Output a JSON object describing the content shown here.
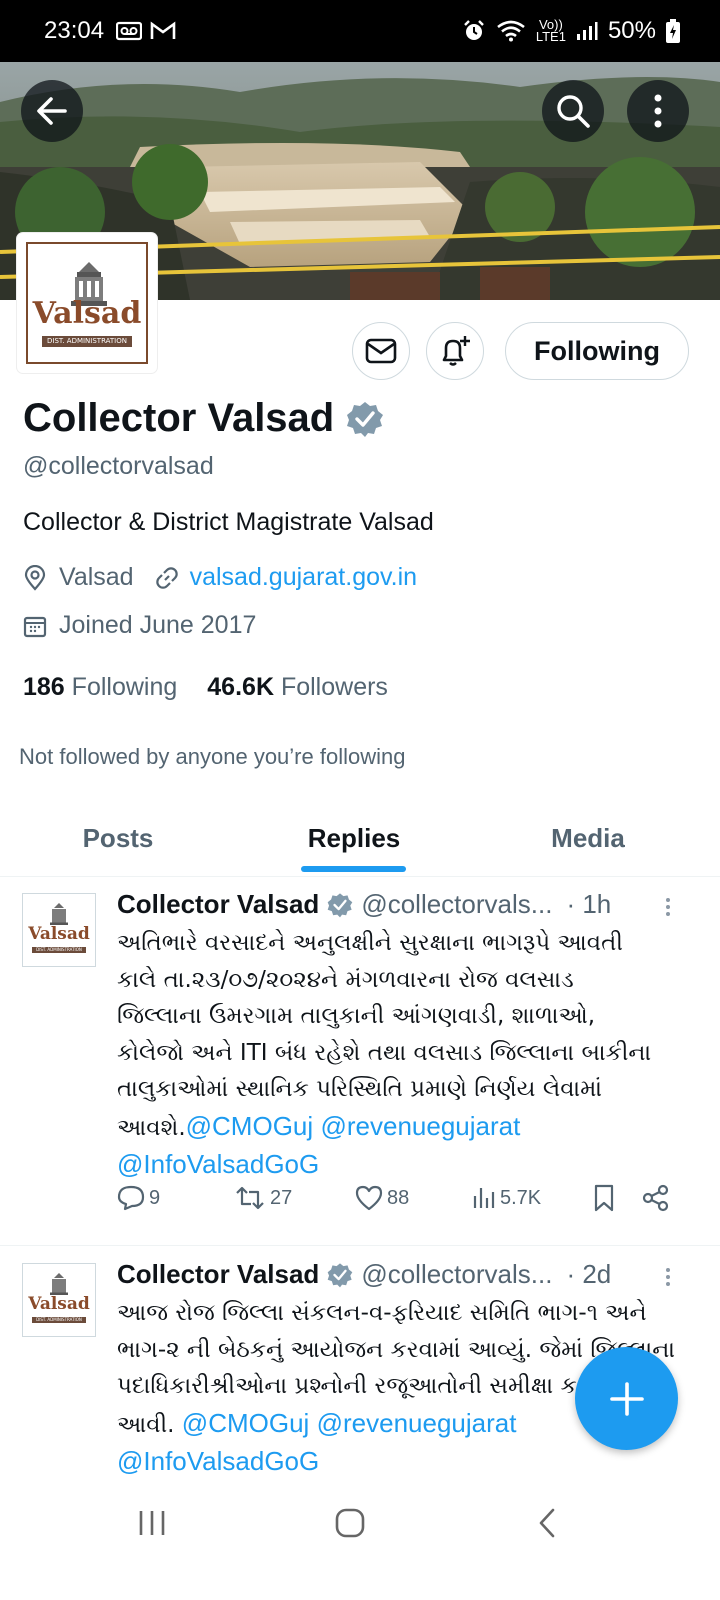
{
  "status_bar": {
    "time": "23:04",
    "network_label_top": "Vo))",
    "network_label_bottom": "LTE1",
    "battery": "50%"
  },
  "header_icons": {
    "back": "back-arrow-icon",
    "search": "search-icon",
    "more": "more-vertical-icon"
  },
  "profile": {
    "avatar_word": "Valsad",
    "avatar_subtitle": "DIST. ADMINISTRATION",
    "following_button": "Following",
    "name": "Collector Valsad",
    "handle": "@collectorvalsad",
    "bio": "Collector & District Magistrate Valsad",
    "location": "Valsad",
    "website": "valsad.gujarat.gov.in",
    "joined": "Joined June 2017",
    "following_count": "186",
    "following_label": "Following",
    "followers_count": "46.6K",
    "followers_label": "Followers",
    "not_followed_text": "Not followed by anyone you’re following"
  },
  "tabs": [
    {
      "label": "Posts",
      "active": false
    },
    {
      "label": "Replies",
      "active": true
    },
    {
      "label": "Media",
      "active": false
    }
  ],
  "tweets": [
    {
      "name": "Collector Valsad",
      "handle": "@collectorvals...",
      "time": "· 1h",
      "lines": [
        "અતિભારે વરસાદને અનુલક્ષીને સુરક્ષાના ભાગરૂપે આવતી",
        "કાલે તા.૨૩/૦૭/૨૦૨૪ને મંગળવારના રોજ વલસાડ",
        "જિલ્લાના ઉમરગામ તાલુકાની આંગણવાડી, શાળાઓ,",
        "કોલેજો અને ITI બંધ રહેશે તથા વલસાડ જિલ્લાના બાકીના",
        "તાલુકાઓમાં સ્થાનિક પરિસ્થિતિ પ્રમાણે નિર્ણય લેવામાં"
      ],
      "last_line_text": "આવશે.",
      "mention1": "@CMOGuj",
      "mention2": "@revenuegujarat",
      "mention3": "@InfoValsadGoG",
      "replies": "9",
      "reposts": "27",
      "likes": "88",
      "views": "5.7K"
    },
    {
      "name": "Collector Valsad",
      "handle": "@collectorvals...",
      "time": "· 2d",
      "lines": [
        "આજ રોજ જિલ્લા સંકલન-વ-ફરિયાદ સમિતિ ભાગ-૧ અને",
        "ભાગ-૨ ની બેઠકનું આયોજન કરવામાં આવ્યું. જેમાં જિલ્લાના",
        "પદાધિકારીશ્રીઓના પ્રશ્નોની રજૂઆતોની સમીક્ષા કરવામાં"
      ],
      "last_line_text": "આવી.",
      "mention1": "@CMOGuj",
      "mention2": "@revenuegujarat",
      "mention3": "@InfoValsadGoG"
    }
  ],
  "fab_icon": "plus-icon",
  "nav_bar": [
    "recent-apps-icon",
    "home-icon",
    "back-icon"
  ]
}
